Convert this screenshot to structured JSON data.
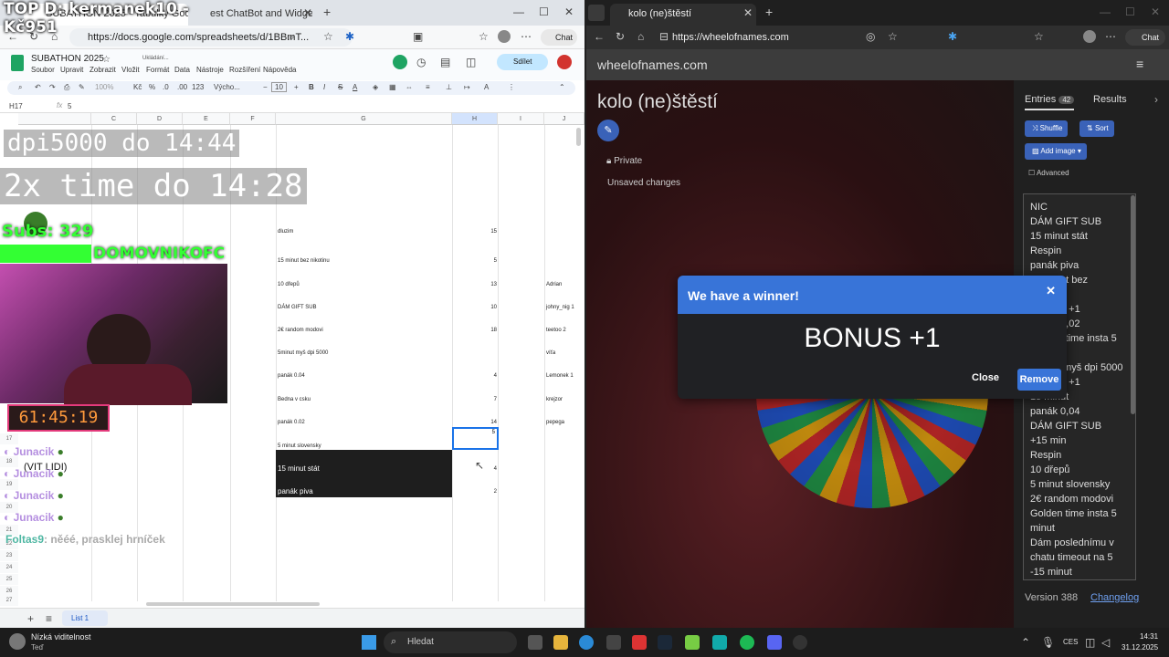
{
  "overlay": {
    "title": "TOP D: kermanek10 - Kč951",
    "dpi_line": "dpi5000 do 14:44",
    "time_line": "2x time do 14:28",
    "subs": "Subs: 329",
    "follower_right": "DOMOVNIKOFC",
    "timer": "61:45:19",
    "chat_user": "Junacik",
    "chat_line2": "(VIT LIDI)",
    "chat_last_user": "Foltas9",
    "chat_last_msg": ": něéé, prasklej hrníček"
  },
  "left_browser": {
    "tab1": "SUBATHON 2025 - Tabulky Google",
    "tab2": "est ChatBot and Widgets for",
    "url": "https://docs.google.com/spreadsheets/d/1BBmT...",
    "copilot": "Chat"
  },
  "sheet": {
    "title": "SUBATHON 2025",
    "saving": "Ukládání...",
    "menu": [
      "Soubor",
      "Upravit",
      "Zobrazit",
      "Vložit",
      "Formát",
      "Data",
      "Nástroje",
      "Rozšíření",
      "Nápověda"
    ],
    "share": "Sdílet",
    "zoom": "100%",
    "currency": "Kč",
    "percent": "%",
    "dec1": ".0",
    "dec2": ".00",
    "numfmt": "123",
    "font": "Výcho...",
    "font_size": "10",
    "cell_ref": "H17",
    "formula": "5",
    "col_headers": [
      "C",
      "D",
      "E",
      "F",
      "G",
      "H",
      "I",
      "J"
    ],
    "rows": [
      {
        "label": "dluzim",
        "value": "15",
        "name": ""
      },
      {
        "label": "15 minut bez nikotinu",
        "value": "5",
        "name": ""
      },
      {
        "label": "10 dřepů",
        "value": "13",
        "name": "Adrian"
      },
      {
        "label": "DÁM GIFT SUB",
        "value": "10",
        "name": "johny_nig 1"
      },
      {
        "label": "2€ random modovi",
        "value": "18",
        "name": "teetoo 2"
      },
      {
        "label": "5minut myš dpi 5000",
        "value": "",
        "name": "víťa"
      },
      {
        "label": "panák 0.04",
        "value": "4",
        "name": "Lemonek 1"
      },
      {
        "label": "Bedna v csku",
        "value": "7",
        "name": "krejzor"
      },
      {
        "label": "panák 0.02",
        "value": "14",
        "name": "pepega"
      },
      {
        "label": "5 minut slovensky",
        "value": "5",
        "name": ""
      },
      {
        "label": "15 minut stát",
        "value": "4",
        "name": ""
      },
      {
        "label": "panák piva",
        "value": "2",
        "name": ""
      }
    ],
    "row_numbers": [
      "17",
      "18",
      "19",
      "20",
      "21",
      "22",
      "23",
      "24",
      "25",
      "26",
      "27"
    ],
    "sheet_tab": "List 1"
  },
  "right_browser": {
    "tab": "kolo (ne)štěstí",
    "url": "https://wheelofnames.com",
    "copilot": "Chat"
  },
  "wheel": {
    "site": "wheelofnames.com",
    "title": "kolo (ne)štěstí",
    "private": "Private",
    "unsaved": "Unsaved changes",
    "entries_tab": "Entries",
    "entries_count": "42",
    "results_tab": "Results",
    "shuffle": "Shuffle",
    "sort": "Sort",
    "add_image": "Add image",
    "advanced": "Advanced",
    "entries": [
      "NIC",
      "DÁM GIFT SUB",
      "15 minut stát",
      "Respin",
      "panák piva",
      "15 minut bez",
      "nikotinu",
      "BONUS +1",
      "panák 0,02",
      "Golden time insta 5",
      "minut",
      "5minut myš dpi 5000",
      "BONUS +1",
      "15 minut",
      "panák 0,04",
      "DÁM GIFT SUB",
      "+15 min",
      "Respin",
      "10 dřepů",
      "5 minut slovensky",
      "2€ random modovi",
      "Golden time insta 5",
      "minut",
      "Dám poslednímu v",
      "chatu timeout na 5",
      "-15 minut"
    ],
    "version": "Version 388",
    "changelog": "Changelog",
    "modal_title": "We have a winner!",
    "winner": "BONUS +1",
    "close": "Close",
    "remove": "Remove"
  },
  "taskbar": {
    "weather": "Nízká viditelnost",
    "weather_sub": "Teď",
    "search": "Hledat",
    "lang": "CES",
    "time": "14:31",
    "date": "31.12.2025"
  }
}
